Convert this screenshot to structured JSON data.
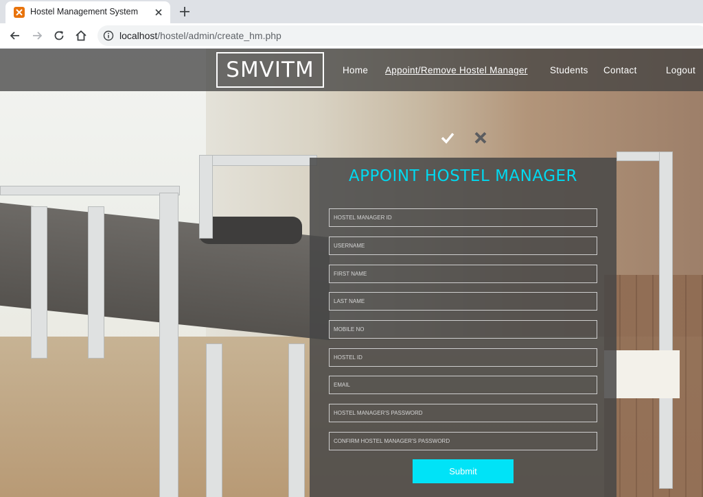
{
  "browser": {
    "tab_title": "Hostel Management System",
    "url_host": "localhost",
    "url_path": "/hostel/admin/create_hm.php"
  },
  "nav": {
    "logo": "SMVITM",
    "items": [
      {
        "label": "Home"
      },
      {
        "label": "Appoint/Remove Hostel Manager"
      },
      {
        "label": "Students"
      },
      {
        "label": "Contact"
      },
      {
        "label": "Logout"
      }
    ],
    "active_index": 1
  },
  "form": {
    "title": "APPOINT HOSTEL MANAGER",
    "fields": [
      {
        "placeholder": "Hostel Manager ID"
      },
      {
        "placeholder": "Username"
      },
      {
        "placeholder": "First Name"
      },
      {
        "placeholder": "Last Name"
      },
      {
        "placeholder": "Mobile No"
      },
      {
        "placeholder": "Hostel ID"
      },
      {
        "placeholder": "Email"
      },
      {
        "placeholder": "Hostel Manager's Password"
      },
      {
        "placeholder": "Confirm Hostel Manager's Password"
      }
    ],
    "submit_label": "Submit"
  },
  "colors": {
    "accent": "#00d9f0",
    "submit_bg": "#00e3f7",
    "nav_bg": "#404040"
  }
}
